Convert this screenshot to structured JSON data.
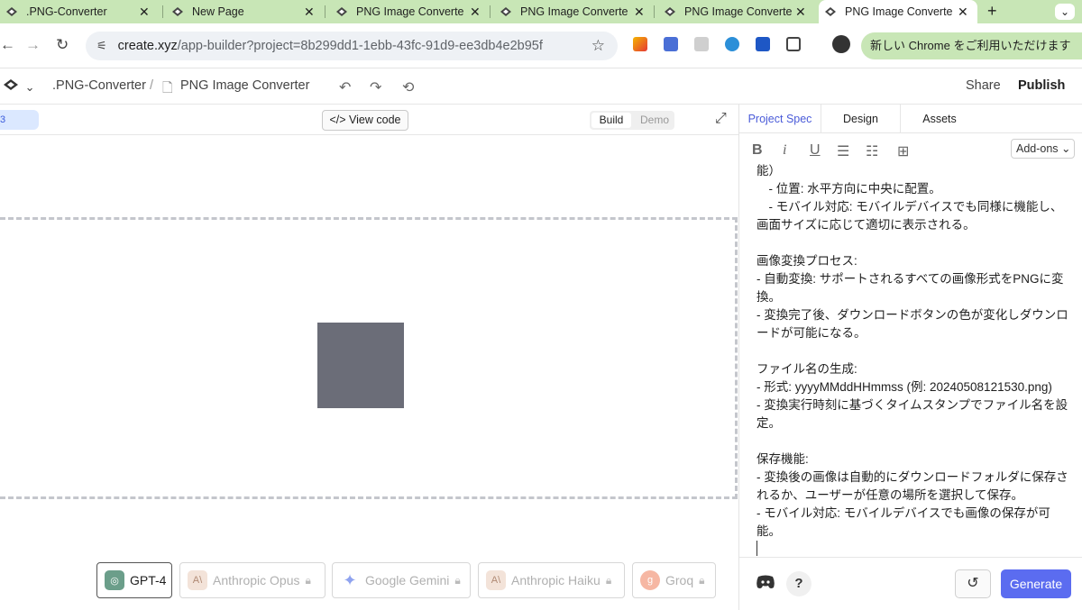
{
  "browser": {
    "tabs": [
      {
        "title": ".PNG-Converter",
        "close": "✕"
      },
      {
        "title": "New Page",
        "close": "✕"
      },
      {
        "title": "PNG Image Converte",
        "close": "✕"
      },
      {
        "title": "PNG Image Converte",
        "close": "✕"
      },
      {
        "title": "PNG Image Converte",
        "close": "✕"
      },
      {
        "title": "PNG Image Converte",
        "close": "✕"
      }
    ],
    "new_tab": "+",
    "url_host": "create.xyz",
    "url_path": "/app-builder?project=8b299dd1-1ebb-43fc-91d9-ee3db4e2b95f",
    "chrome_banner": "新しい Chrome をご利用いただけます"
  },
  "header": {
    "project": ".PNG-Converter",
    "separator": "/",
    "page": "PNG Image Converter",
    "share": "Share",
    "publish": "Publish"
  },
  "toolbar": {
    "left_badge": "3",
    "view_code": "View code",
    "build": "Build",
    "demo": "Demo"
  },
  "models": [
    {
      "label": "GPT-4",
      "icon_text": "◎",
      "color": "#6b9e8a"
    },
    {
      "label": "Anthropic Opus",
      "icon_text": "A\\",
      "color": "#e8c9b8"
    },
    {
      "label": "Google Gemini",
      "icon_text": "✦",
      "color": "#b9c6f5"
    },
    {
      "label": "Anthropic Haiku",
      "icon_text": "A\\",
      "color": "#e8c9b8"
    },
    {
      "label": "Groq",
      "icon_text": "g",
      "color": "#f1a58b"
    }
  ],
  "panel": {
    "tabs": [
      "Project Spec",
      "Design",
      "Assets"
    ],
    "addons": "Add-ons",
    "spec_text": "能）\n　- 位置: 水平方向に中央に配置。\n　- モバイル対応: モバイルデバイスでも同様に機能し、画面サイズに応じて適切に表示される。\n\n画像変換プロセス:\n- 自動変換: サポートされるすべての画像形式をPNGに変換。\n- 変換完了後、ダウンロードボタンの色が変化しダウンロードが可能になる。\n\nファイル名の生成:\n- 形式: yyyyMMddHHmmss (例: 20240508121530.png)\n- 変換実行時刻に基づくタイムスタンプでファイル名を設定。\n\n保存機能:\n- 変換後の画像は自動的にダウンロードフォルダに保存されるか、ユーザーが任意の場所を選択して保存。\n- モバイル対応: モバイルデバイスでも画像の保存が可能。",
    "generate": "Generate",
    "help": "?"
  }
}
